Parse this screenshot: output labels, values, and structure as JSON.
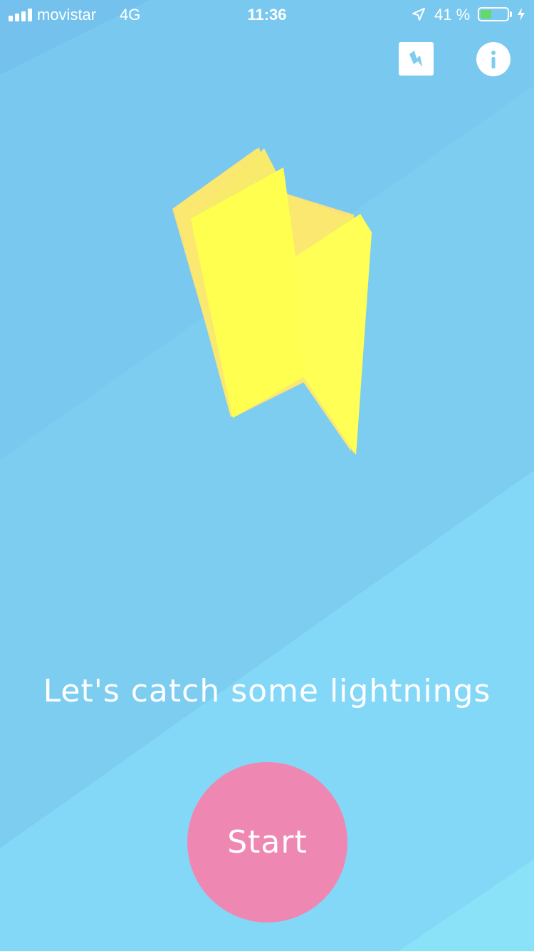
{
  "status_bar": {
    "carrier": "movistar",
    "network": "4G",
    "time": "11:36",
    "battery_percent_label": "41 %",
    "battery_level": 0.41,
    "icons": {
      "signal": "signal-bars-icon",
      "location": "location-arrow-icon",
      "battery": "battery-icon",
      "charging": "charging-bolt-icon"
    }
  },
  "header": {
    "logo_icon": "lightning-logo-icon",
    "info_icon": "info-icon"
  },
  "hero": {
    "icon": "lightning-bolt-icon",
    "tagline": "Let's catch some lightnings"
  },
  "actions": {
    "start_label": "Start"
  },
  "colors": {
    "background": "#7dcdf1",
    "band_light": "#86dbf8",
    "band_dark": "#78c6ef",
    "bolt_face": "#ffff55",
    "bolt_side": "#f9e07a",
    "start_button": "#ee88b3",
    "battery_fill": "#63d96a"
  }
}
